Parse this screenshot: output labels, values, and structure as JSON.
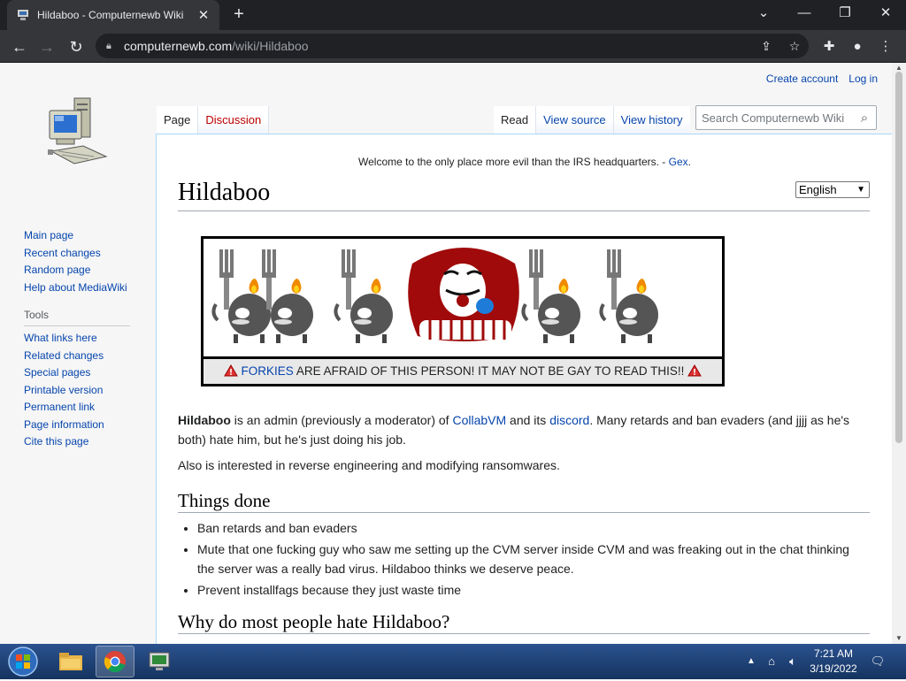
{
  "browser": {
    "tab_title": "Hildaboo - Computernewb Wiki",
    "url_host": "computernewb.com",
    "url_path": "/wiki/Hildaboo"
  },
  "personal": {
    "create_account": "Create account",
    "log_in": "Log in"
  },
  "sidebar": {
    "nav": [
      "Main page",
      "Recent changes",
      "Random page",
      "Help about MediaWiki"
    ],
    "tools_heading": "Tools",
    "tools": [
      "What links here",
      "Related changes",
      "Special pages",
      "Printable version",
      "Permanent link",
      "Page information",
      "Cite this page"
    ]
  },
  "tabs": {
    "page": "Page",
    "discussion": "Discussion",
    "read": "Read",
    "view_source": "View source",
    "view_history": "View history"
  },
  "search": {
    "placeholder": "Search Computernewb Wiki"
  },
  "sitenotice": {
    "text": "Welcome to the only place more evil than the IRS headquarters. - ",
    "link": "Gex",
    "end": "."
  },
  "language": {
    "selected": "English"
  },
  "title": "Hildaboo",
  "banner": {
    "link": "FORKIES",
    "text": " ARE AFRAID OF THIS PERSON! IT MAY NOT BE GAY TO READ THIS!!"
  },
  "intro": {
    "bold": "Hildaboo",
    "t1": " is an admin (previously a moderator) of ",
    "link1": "CollabVM",
    "t2": " and its ",
    "link2": "discord",
    "t3": ". Many retards and ban evaders (and jjjj as he's both) hate him, but he's just doing his job."
  },
  "intro2": "Also is interested in reverse engineering and modifying ransomwares.",
  "section1": {
    "heading": "Things done",
    "items": [
      "Ban retards and ban evaders",
      "Mute that one fucking guy who saw me setting up the CVM server inside CVM and was freaking out in the chat thinking the server was a really bad virus. Hildaboo thinks we deserve peace.",
      "Prevent installfags because they just waste time"
    ]
  },
  "section2": {
    "heading": "Why do most people hate Hildaboo?"
  },
  "taskbar": {
    "time": "7:21 AM",
    "date": "3/19/2022"
  }
}
